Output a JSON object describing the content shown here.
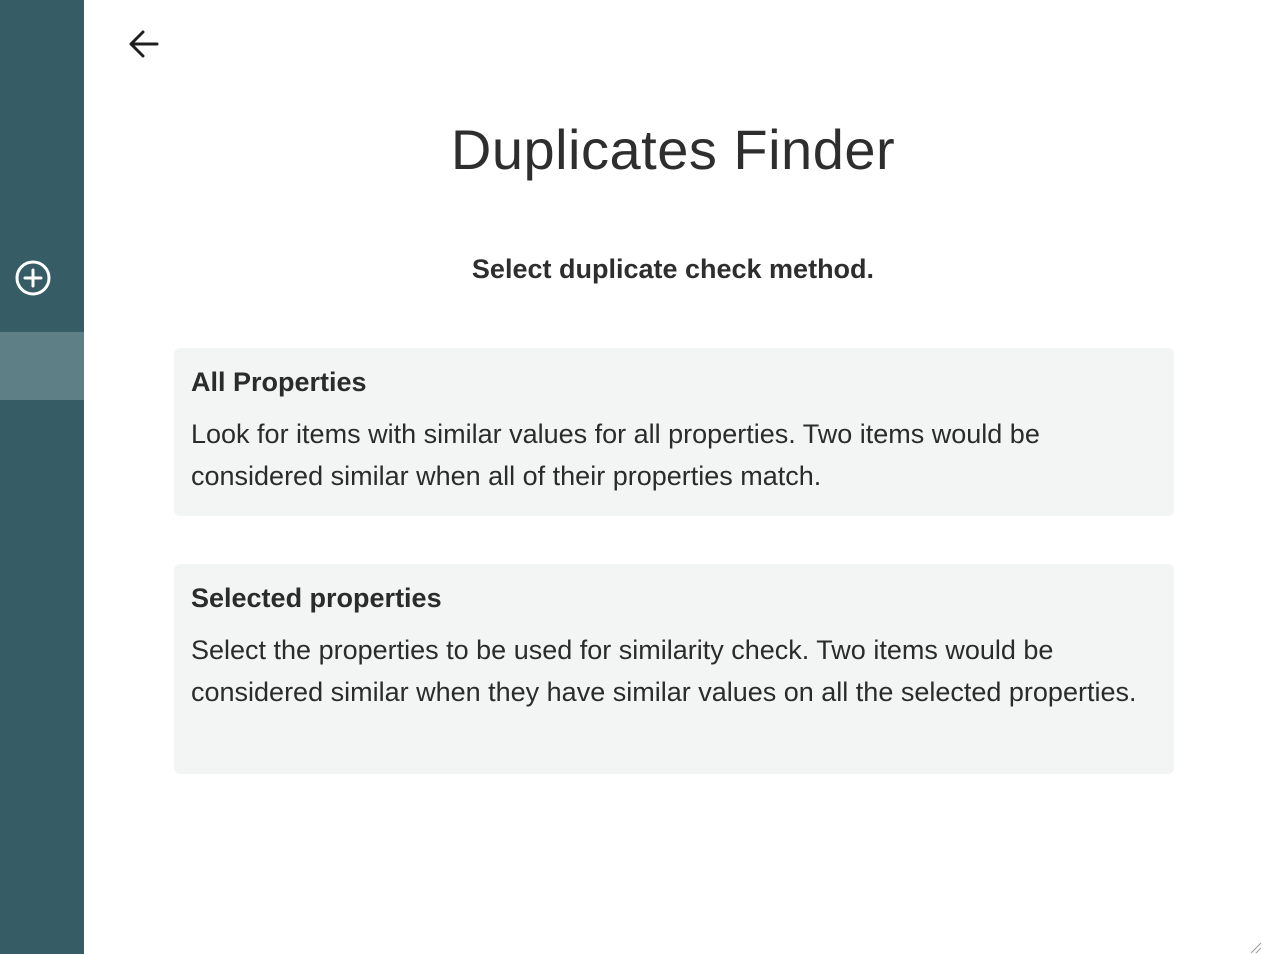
{
  "sidebar": {
    "add_icon": "plus-circle-icon",
    "accent_color": "#365d66",
    "active_color": "#5f7f87"
  },
  "header": {
    "back_icon": "arrow-left-icon",
    "title": "Duplicates Finder",
    "subtitle": "Select duplicate check method."
  },
  "options": [
    {
      "title": "All Properties",
      "description": "Look for items with similar values for all properties. Two items would be considered similar when all of their properties match."
    },
    {
      "title": "Selected properties",
      "description": "Select the properties to be used for similarity check. Two items would be considered similar when they have similar values on all the selected properties."
    }
  ]
}
